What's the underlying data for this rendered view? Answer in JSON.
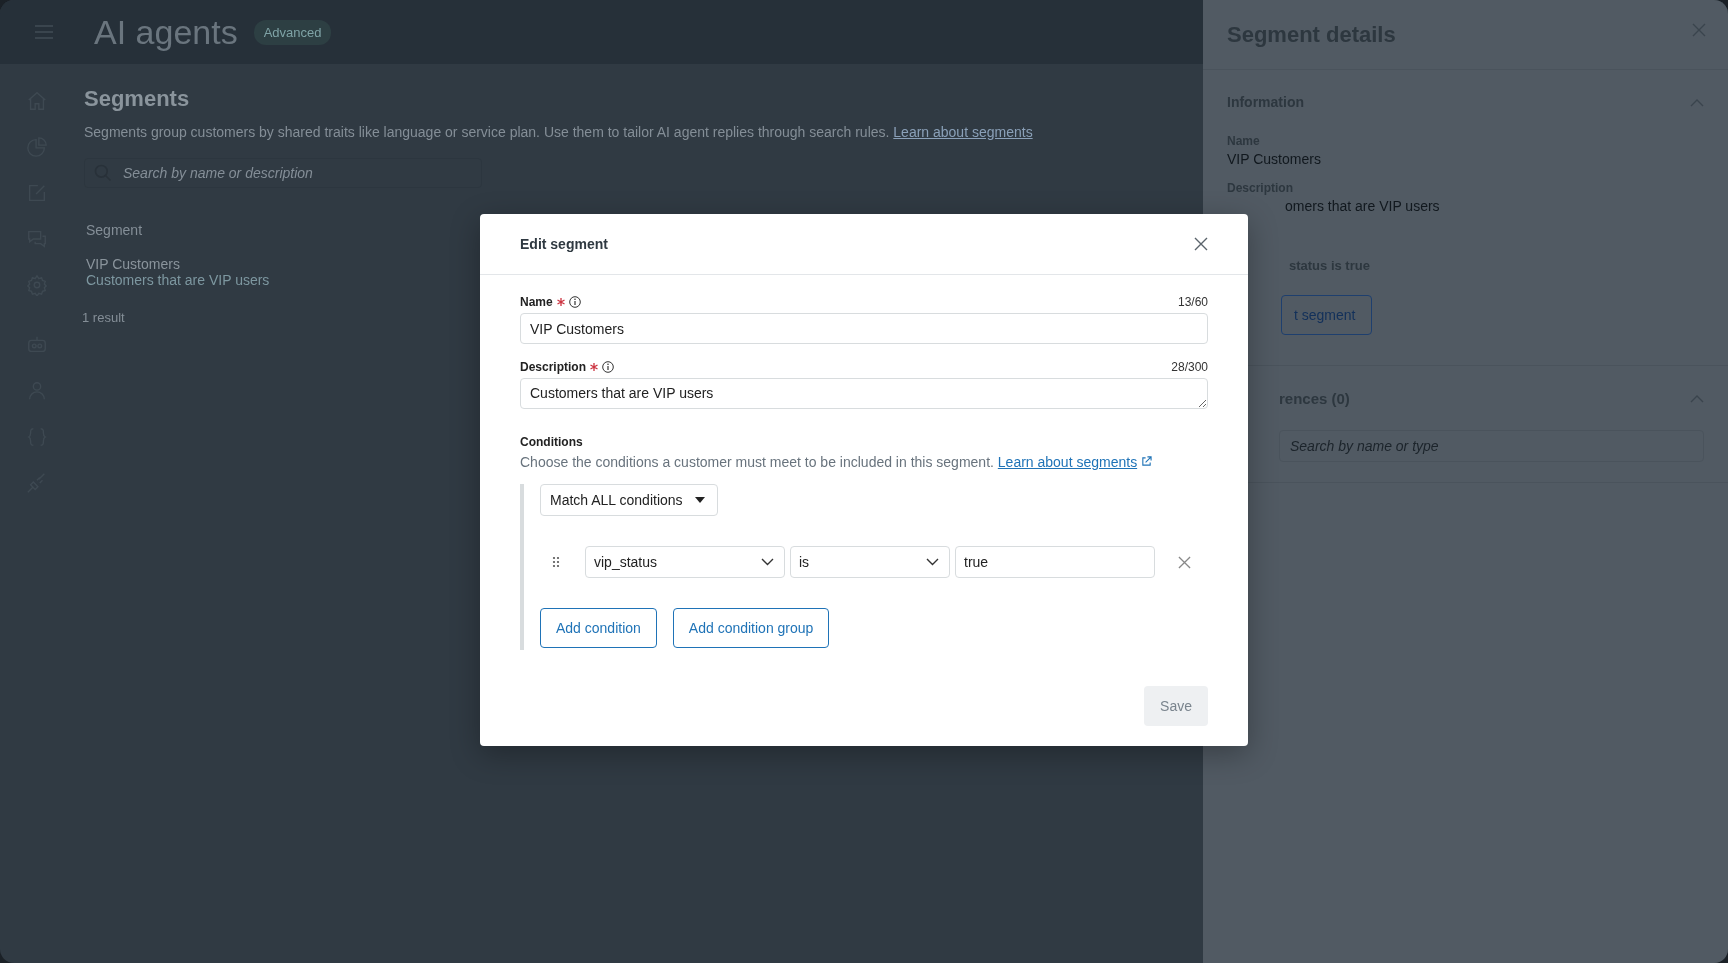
{
  "header": {
    "title": "AI agents",
    "badge": "Advanced"
  },
  "page": {
    "title": "Segments",
    "description": "Segments group customers by shared traits like language or service plan. Use them to tailor AI agent replies through search rules.",
    "link": "Learn about segments",
    "search_placeholder": "Search by name or description",
    "table": {
      "columns": [
        "Segment"
      ],
      "rows": [
        {
          "name": "VIP Customers",
          "description": "Customers that are VIP users"
        }
      ]
    },
    "result_count": "1 result"
  },
  "details_panel": {
    "title": "Segment details",
    "sections": [
      {
        "title": "Information",
        "expanded": true,
        "fields": [
          {
            "label": "Name",
            "value": "VIP Customers"
          },
          {
            "label": "Description",
            "value": "omers that are VIP users"
          }
        ],
        "condition": "status is true",
        "button": "t segment"
      },
      {
        "title": "rences (0)",
        "expanded": true,
        "search_placeholder": "Search by name or type"
      }
    ]
  },
  "modal": {
    "title": "Edit segment",
    "fields": [
      {
        "label": "Name",
        "required": true,
        "counter": "13/60",
        "value": "VIP Customers",
        "kind": "input"
      },
      {
        "label": "Description",
        "required": true,
        "counter": "28/300",
        "value": "Customers that are VIP users",
        "kind": "textarea"
      }
    ],
    "conditions": {
      "title": "Conditions",
      "help": "Choose the conditions a customer must meet to be included in this segment.",
      "link": "Learn about segments",
      "match": "Match ALL conditions",
      "rows": [
        {
          "field": "vip_status",
          "operator": "is",
          "value": "true"
        }
      ],
      "buttons": [
        "Add condition",
        "Add condition group"
      ]
    },
    "save": {
      "label": "Save",
      "disabled": true
    }
  }
}
